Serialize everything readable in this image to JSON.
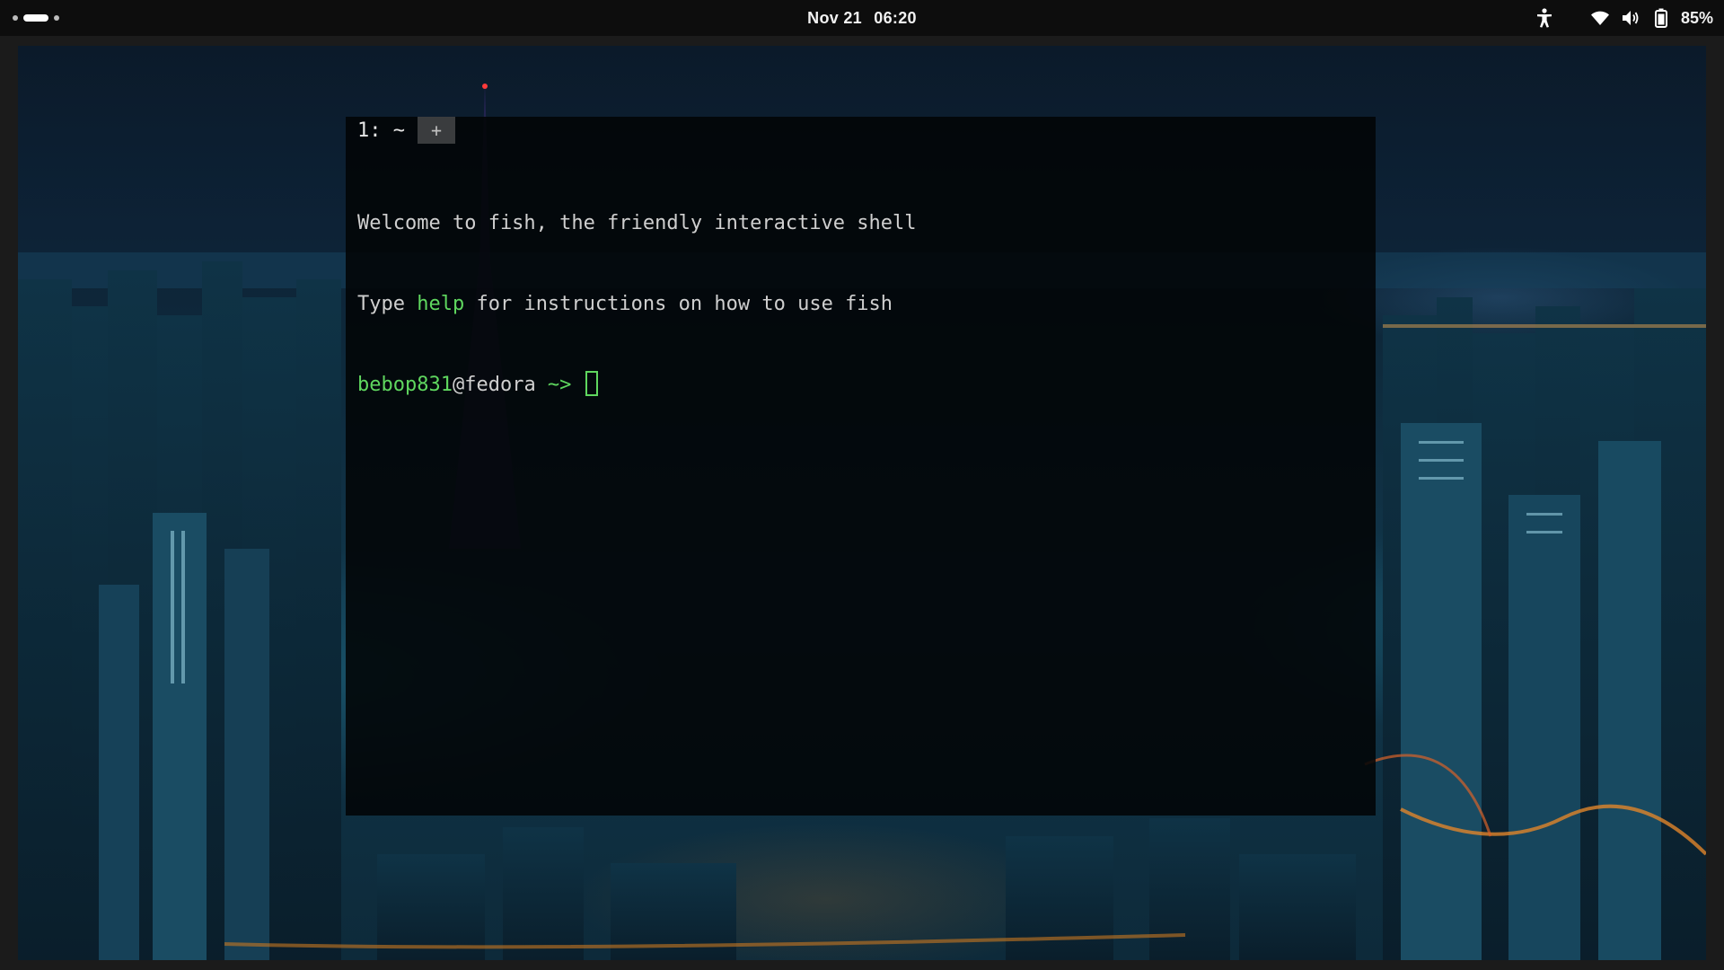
{
  "topbar": {
    "workspaces": {
      "count": 3,
      "active_index": 1
    },
    "clock": {
      "date": "Nov 21",
      "time": "06:20"
    },
    "tray": {
      "icons": [
        "accessibility-icon",
        "wifi-icon",
        "volume-icon",
        "battery-icon"
      ],
      "battery_percent": "85%"
    }
  },
  "terminal": {
    "tab": {
      "label": "1: ~",
      "add_label": "+"
    },
    "lines": {
      "welcome": "Welcome to fish, the friendly interactive shell",
      "help_prefix": "Type ",
      "help_word": "help",
      "help_suffix": " for instructions on how to use fish"
    },
    "prompt": {
      "user": "bebop831",
      "host": "@fedora",
      "cwd": " ~> "
    }
  },
  "colors": {
    "prompt_green": "#5fd75f",
    "terminal_bg": "#020406",
    "topbar_bg": "#0d0d0d"
  }
}
